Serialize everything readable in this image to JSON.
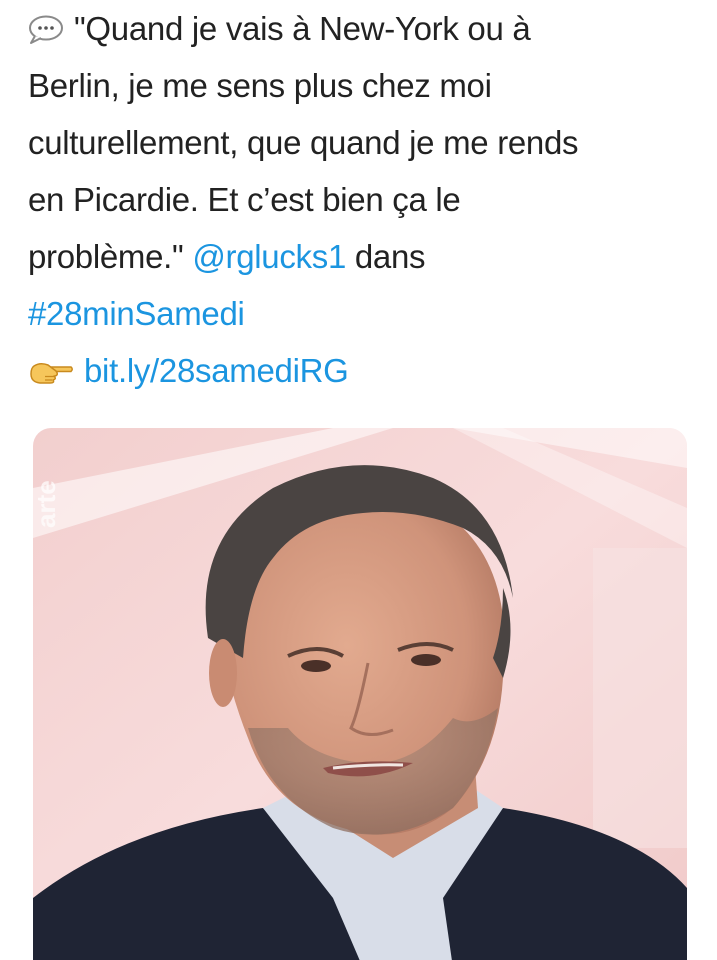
{
  "tweet": {
    "icon": "speech-bubble-icon",
    "lines": [
      "\"Quand je vais à New-York ou à",
      "Berlin, je me sens plus chez moi",
      "culturellement, que quand je me rends",
      "en Picardie. Et c’est bien ça le",
      "problème.\" "
    ],
    "mention": "@rglucks1",
    "after_mention": " dans",
    "hashtag": "#28minSamedi",
    "link_icon": "pointing-hand-icon",
    "link": "bit.ly/28samediRG"
  },
  "media": {
    "watermark": "arte",
    "description_icon": "man-portrait-photo"
  },
  "colors": {
    "text": "#222222",
    "link": "#1b95e0",
    "background": "#ffffff"
  }
}
